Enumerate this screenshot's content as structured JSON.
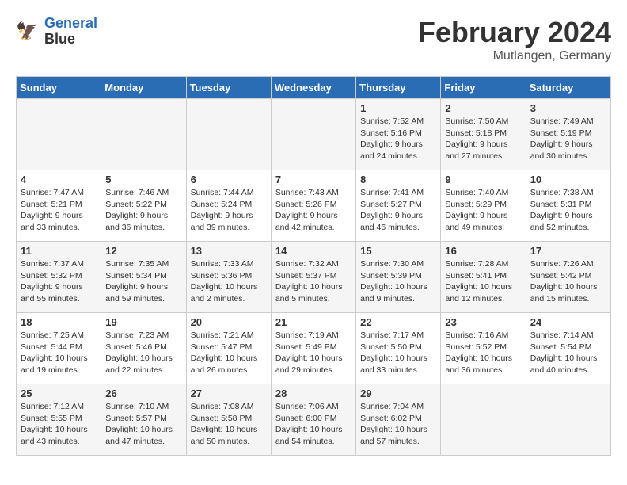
{
  "header": {
    "logo_line1": "General",
    "logo_line2": "Blue",
    "month_title": "February 2024",
    "location": "Mutlangen, Germany"
  },
  "days_of_week": [
    "Sunday",
    "Monday",
    "Tuesday",
    "Wednesday",
    "Thursday",
    "Friday",
    "Saturday"
  ],
  "weeks": [
    [
      {
        "day": "",
        "content": ""
      },
      {
        "day": "",
        "content": ""
      },
      {
        "day": "",
        "content": ""
      },
      {
        "day": "",
        "content": ""
      },
      {
        "day": "1",
        "content": "Sunrise: 7:52 AM\nSunset: 5:16 PM\nDaylight: 9 hours\nand 24 minutes."
      },
      {
        "day": "2",
        "content": "Sunrise: 7:50 AM\nSunset: 5:18 PM\nDaylight: 9 hours\nand 27 minutes."
      },
      {
        "day": "3",
        "content": "Sunrise: 7:49 AM\nSunset: 5:19 PM\nDaylight: 9 hours\nand 30 minutes."
      }
    ],
    [
      {
        "day": "4",
        "content": "Sunrise: 7:47 AM\nSunset: 5:21 PM\nDaylight: 9 hours\nand 33 minutes."
      },
      {
        "day": "5",
        "content": "Sunrise: 7:46 AM\nSunset: 5:22 PM\nDaylight: 9 hours\nand 36 minutes."
      },
      {
        "day": "6",
        "content": "Sunrise: 7:44 AM\nSunset: 5:24 PM\nDaylight: 9 hours\nand 39 minutes."
      },
      {
        "day": "7",
        "content": "Sunrise: 7:43 AM\nSunset: 5:26 PM\nDaylight: 9 hours\nand 42 minutes."
      },
      {
        "day": "8",
        "content": "Sunrise: 7:41 AM\nSunset: 5:27 PM\nDaylight: 9 hours\nand 46 minutes."
      },
      {
        "day": "9",
        "content": "Sunrise: 7:40 AM\nSunset: 5:29 PM\nDaylight: 9 hours\nand 49 minutes."
      },
      {
        "day": "10",
        "content": "Sunrise: 7:38 AM\nSunset: 5:31 PM\nDaylight: 9 hours\nand 52 minutes."
      }
    ],
    [
      {
        "day": "11",
        "content": "Sunrise: 7:37 AM\nSunset: 5:32 PM\nDaylight: 9 hours\nand 55 minutes."
      },
      {
        "day": "12",
        "content": "Sunrise: 7:35 AM\nSunset: 5:34 PM\nDaylight: 9 hours\nand 59 minutes."
      },
      {
        "day": "13",
        "content": "Sunrise: 7:33 AM\nSunset: 5:36 PM\nDaylight: 10 hours\nand 2 minutes."
      },
      {
        "day": "14",
        "content": "Sunrise: 7:32 AM\nSunset: 5:37 PM\nDaylight: 10 hours\nand 5 minutes."
      },
      {
        "day": "15",
        "content": "Sunrise: 7:30 AM\nSunset: 5:39 PM\nDaylight: 10 hours\nand 9 minutes."
      },
      {
        "day": "16",
        "content": "Sunrise: 7:28 AM\nSunset: 5:41 PM\nDaylight: 10 hours\nand 12 minutes."
      },
      {
        "day": "17",
        "content": "Sunrise: 7:26 AM\nSunset: 5:42 PM\nDaylight: 10 hours\nand 15 minutes."
      }
    ],
    [
      {
        "day": "18",
        "content": "Sunrise: 7:25 AM\nSunset: 5:44 PM\nDaylight: 10 hours\nand 19 minutes."
      },
      {
        "day": "19",
        "content": "Sunrise: 7:23 AM\nSunset: 5:46 PM\nDaylight: 10 hours\nand 22 minutes."
      },
      {
        "day": "20",
        "content": "Sunrise: 7:21 AM\nSunset: 5:47 PM\nDaylight: 10 hours\nand 26 minutes."
      },
      {
        "day": "21",
        "content": "Sunrise: 7:19 AM\nSunset: 5:49 PM\nDaylight: 10 hours\nand 29 minutes."
      },
      {
        "day": "22",
        "content": "Sunrise: 7:17 AM\nSunset: 5:50 PM\nDaylight: 10 hours\nand 33 minutes."
      },
      {
        "day": "23",
        "content": "Sunrise: 7:16 AM\nSunset: 5:52 PM\nDaylight: 10 hours\nand 36 minutes."
      },
      {
        "day": "24",
        "content": "Sunrise: 7:14 AM\nSunset: 5:54 PM\nDaylight: 10 hours\nand 40 minutes."
      }
    ],
    [
      {
        "day": "25",
        "content": "Sunrise: 7:12 AM\nSunset: 5:55 PM\nDaylight: 10 hours\nand 43 minutes."
      },
      {
        "day": "26",
        "content": "Sunrise: 7:10 AM\nSunset: 5:57 PM\nDaylight: 10 hours\nand 47 minutes."
      },
      {
        "day": "27",
        "content": "Sunrise: 7:08 AM\nSunset: 5:58 PM\nDaylight: 10 hours\nand 50 minutes."
      },
      {
        "day": "28",
        "content": "Sunrise: 7:06 AM\nSunset: 6:00 PM\nDaylight: 10 hours\nand 54 minutes."
      },
      {
        "day": "29",
        "content": "Sunrise: 7:04 AM\nSunset: 6:02 PM\nDaylight: 10 hours\nand 57 minutes."
      },
      {
        "day": "",
        "content": ""
      },
      {
        "day": "",
        "content": ""
      }
    ]
  ]
}
